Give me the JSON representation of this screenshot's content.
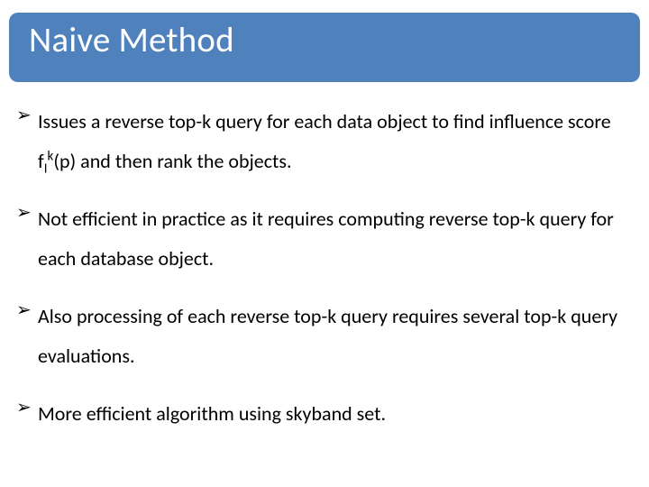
{
  "slide": {
    "title": "Naive Method",
    "bullets": [
      {
        "pre": "Issues a reverse top-k query for each data object to find influence score f",
        "sub": "I",
        "sup": "k",
        "post": "(p) and then rank the objects."
      },
      {
        "pre": "Not efficient in practice as it requires computing reverse top-k query for each database object.",
        "sub": "",
        "sup": "",
        "post": ""
      },
      {
        "pre": "Also processing of each reverse top-k query requires several top-k query evaluations.",
        "sub": "",
        "sup": "",
        "post": ""
      },
      {
        "pre": "More efficient algorithm using skyband set.",
        "sub": "",
        "sup": "",
        "post": ""
      }
    ],
    "bullet_glyph": "➢"
  }
}
